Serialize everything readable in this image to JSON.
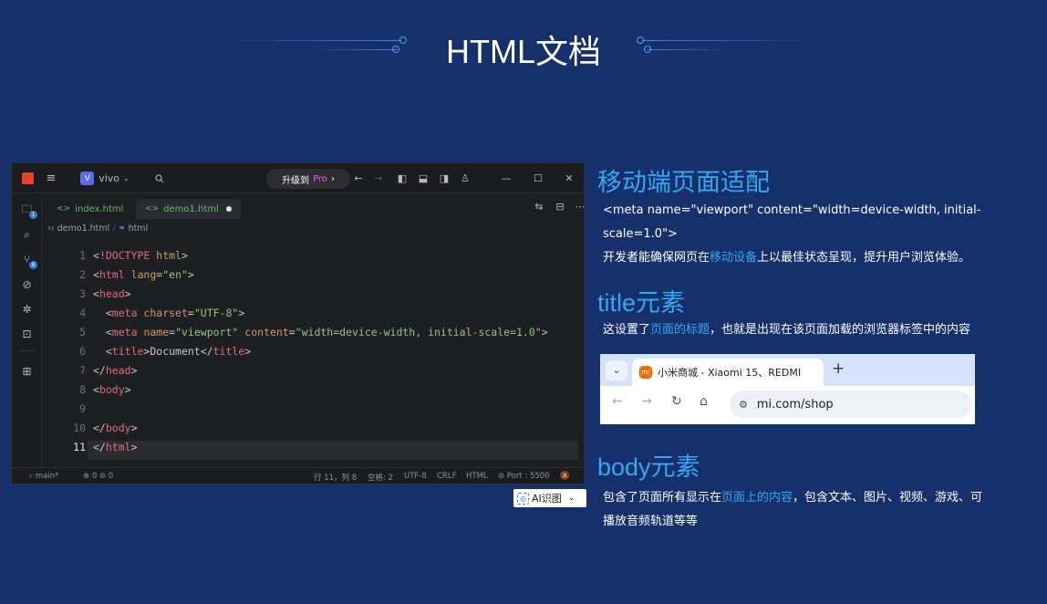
{
  "page_title": "HTML文档",
  "editor": {
    "project": "vivo",
    "project_badge": "V",
    "upgrade_label": "升级到",
    "upgrade_pro": "Pro",
    "tabs": [
      {
        "label": "index.html",
        "glyph": "<>"
      },
      {
        "label": "demo1.html",
        "glyph": "<>"
      }
    ],
    "breadcrumb": {
      "file": "demo1.html",
      "sep": "/",
      "node": "html"
    },
    "badges": {
      "explorer": "1",
      "git": "6"
    },
    "lines": [
      "1",
      "2",
      "3",
      "4",
      "5",
      "6",
      "7",
      "8",
      "9",
      "10",
      "11"
    ],
    "status": {
      "branch": "main*",
      "problems": "0",
      "warnings": "0",
      "position": "行 11，列 8",
      "spaces": "空格: 2",
      "encoding": "UTF-8",
      "eol": "CRLF",
      "lang": "HTML",
      "port": "Port : 5500"
    }
  },
  "ai_button": {
    "label": "AI识图"
  },
  "sections": {
    "mobile": {
      "title": "移动端页面适配",
      "code_line": "<meta name=\"viewport\" content=\"width=device-width, initial-",
      "code_line2": "scale=1.0\">",
      "desc_pre": "开发者能确保网页在",
      "desc_hl": "移动设备",
      "desc_post": "上以最佳状态呈现，提升用户浏览体验。"
    },
    "title_el": {
      "title": "title元素",
      "desc_pre": "这设置了",
      "desc_hl": "页面的标题",
      "desc_post": "，也就是出现在该页面加载的浏览器标签中的内容"
    },
    "body_el": {
      "title": "body元素",
      "desc_pre": "包含了页面所有显示在",
      "desc_hl": "页面上的内容",
      "desc_post": "，包含文本、图片、视频、游戏、可",
      "desc_line2": "播放音频轨道等等"
    }
  },
  "browser": {
    "tab_title": "小米商城 - Xiaomi 15、REDMI",
    "favicon": "mi",
    "url": "mi.com/shop"
  }
}
